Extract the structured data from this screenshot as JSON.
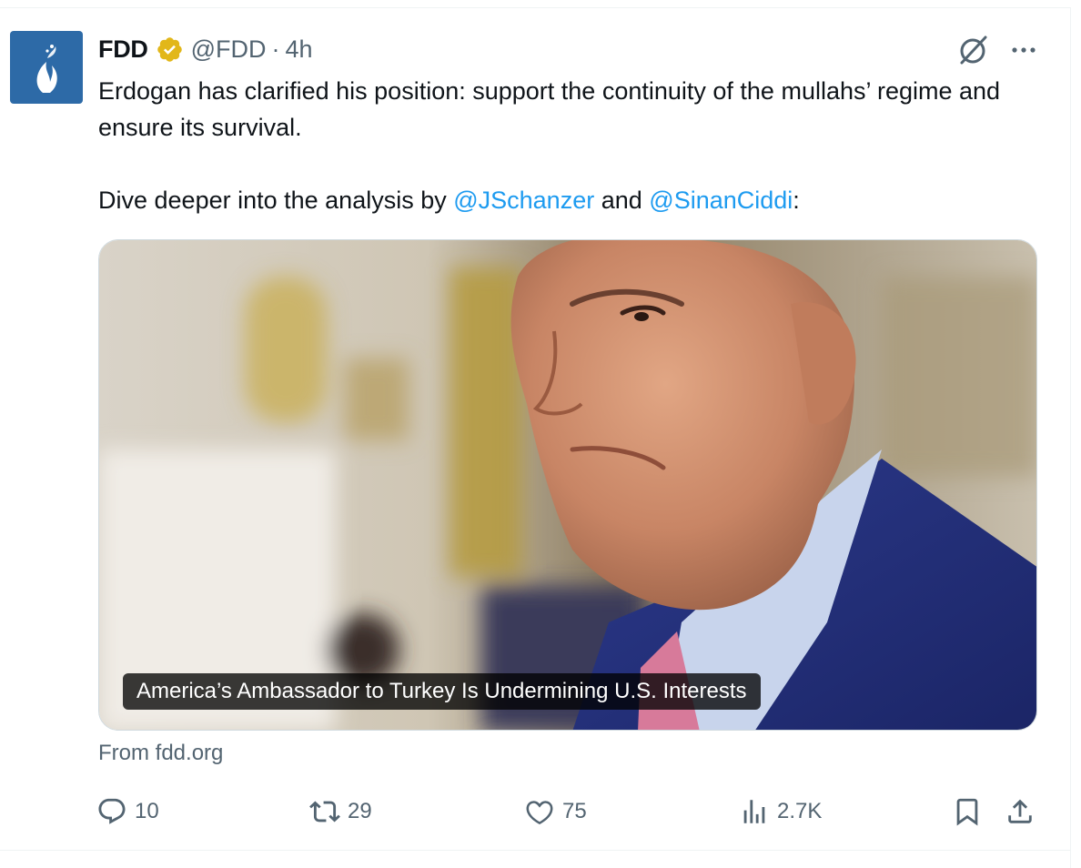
{
  "author": {
    "name": "FDD",
    "handle": "@FDD",
    "separator": "·",
    "time": "4h",
    "avatar_icon": "fdd-flame-logo-icon",
    "verified_icon": "gold-verified-badge-icon"
  },
  "tweet": {
    "line1": "Erdogan has clarified his position: support the continuity of the mullahs’ regime and ensure its survival.",
    "line2_prefix": "Dive deeper into the analysis by ",
    "mention1": "@JSchanzer",
    "line2_mid": " and ",
    "mention2": "@SinanCiddi",
    "line2_suffix": ":"
  },
  "card": {
    "title": "America’s Ambassador to Turkey Is Undermining U.S. Interests",
    "source": "From fdd.org",
    "image_description_icon": "article-photo"
  },
  "actions": {
    "reply_count": "10",
    "repost_count": "29",
    "like_count": "75",
    "views_count": "2.7K"
  },
  "colors": {
    "link": "#1d9bf0",
    "muted": "#536471",
    "text": "#0f1419",
    "avatar_bg": "#2d6aa7",
    "verified": "#e2b719"
  }
}
